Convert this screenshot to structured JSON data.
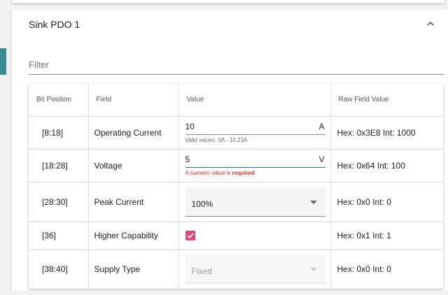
{
  "pdo": {
    "title": "Sink PDO 1"
  },
  "filter": {
    "placeholder": "Filter",
    "value": ""
  },
  "table": {
    "headers": [
      "Bit Position",
      "Field",
      "Value",
      "Raw Field Value"
    ],
    "rows": [
      {
        "bits": "[8:18]",
        "field": "Operating Current",
        "value": "10",
        "unit": "A",
        "hint": "Valid values: 0A - 10.23A",
        "raw": "Hex: 0x3E8 Int: 1000"
      },
      {
        "bits": "[18:28]",
        "field": "Voltage",
        "value": "5",
        "unit": "V",
        "error_prefix": "A numeric value is ",
        "error_bold": "required",
        "raw": "Hex: 0x64 Int: 100"
      },
      {
        "bits": "[28:30]",
        "field": "Peak Current",
        "value": "100%",
        "raw": "Hex: 0x0 Int: 0"
      },
      {
        "bits": "[36]",
        "field": "Higher Capability",
        "checked": true,
        "raw": "Hex: 0x1 Int: 1"
      },
      {
        "bits": "[38:40]",
        "field": "Supply Type",
        "value": "Fixed",
        "disabled": true,
        "raw": "Hex: 0x0 Int: 0"
      }
    ]
  },
  "colors": {
    "accent": "#3b8a94",
    "checkbox": "#e0457b",
    "error": "#d32f2f",
    "focus_underline": "#2e7d8a"
  },
  "icons": {
    "collapse": "chevron-up-icon",
    "dropdown": "dropdown-arrow-icon",
    "check": "checkmark-icon"
  }
}
